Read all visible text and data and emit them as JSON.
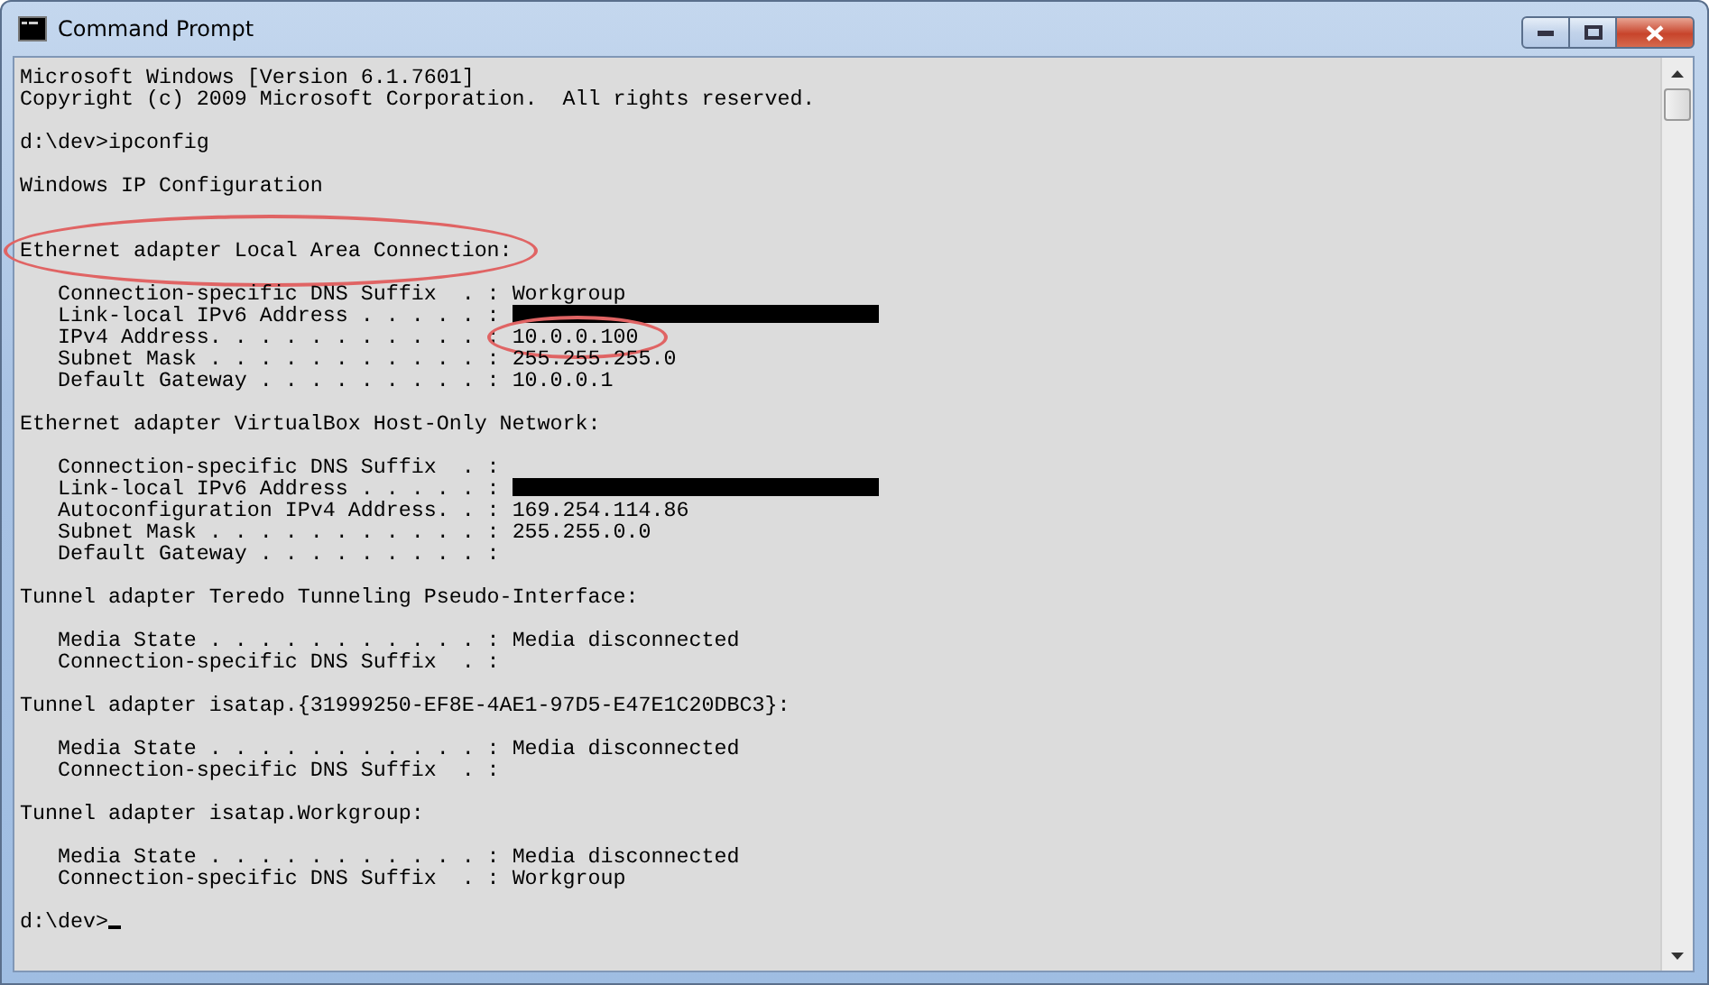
{
  "window": {
    "title": "Command Prompt"
  },
  "console": {
    "lines": [
      {
        "kind": "text",
        "text": "Microsoft Windows [Version 6.1.7601]"
      },
      {
        "kind": "text",
        "text": "Copyright (c) 2009 Microsoft Corporation.  All rights reserved."
      },
      {
        "kind": "blank"
      },
      {
        "kind": "text",
        "text": "d:\\dev>ipconfig"
      },
      {
        "kind": "blank"
      },
      {
        "kind": "text",
        "text": "Windows IP Configuration"
      },
      {
        "kind": "blank"
      },
      {
        "kind": "blank"
      },
      {
        "kind": "text",
        "text": "Ethernet adapter Local Area Connection:",
        "circled": true
      },
      {
        "kind": "blank"
      },
      {
        "kind": "field",
        "label": "Connection-specific DNS Suffix  . :",
        "value": "Workgroup"
      },
      {
        "kind": "field",
        "label": "Link-local IPv6 Address . . . . . :",
        "redacted": true
      },
      {
        "kind": "field",
        "label": "IPv4 Address. . . . . . . . . . . :",
        "value": "10.0.0.100",
        "circled": true
      },
      {
        "kind": "field",
        "label": "Subnet Mask . . . . . . . . . . . :",
        "value": "255.255.255.0"
      },
      {
        "kind": "field",
        "label": "Default Gateway . . . . . . . . . :",
        "value": "10.0.0.1"
      },
      {
        "kind": "blank"
      },
      {
        "kind": "text",
        "text": "Ethernet adapter VirtualBox Host-Only Network:"
      },
      {
        "kind": "blank"
      },
      {
        "kind": "field",
        "label": "Connection-specific DNS Suffix  . :"
      },
      {
        "kind": "field",
        "label": "Link-local IPv6 Address . . . . . :",
        "redacted": true
      },
      {
        "kind": "field",
        "label": "Autoconfiguration IPv4 Address. . :",
        "value": "169.254.114.86"
      },
      {
        "kind": "field",
        "label": "Subnet Mask . . . . . . . . . . . :",
        "value": "255.255.0.0"
      },
      {
        "kind": "field",
        "label": "Default Gateway . . . . . . . . . :"
      },
      {
        "kind": "blank"
      },
      {
        "kind": "text",
        "text": "Tunnel adapter Teredo Tunneling Pseudo-Interface:"
      },
      {
        "kind": "blank"
      },
      {
        "kind": "field",
        "label": "Media State . . . . . . . . . . . :",
        "value": "Media disconnected"
      },
      {
        "kind": "field",
        "label": "Connection-specific DNS Suffix  . :"
      },
      {
        "kind": "blank"
      },
      {
        "kind": "text",
        "text": "Tunnel adapter isatap.{31999250-EF8E-4AE1-97D5-E47E1C20DBC3}:"
      },
      {
        "kind": "blank"
      },
      {
        "kind": "field",
        "label": "Media State . . . . . . . . . . . :",
        "value": "Media disconnected"
      },
      {
        "kind": "field",
        "label": "Connection-specific DNS Suffix  . :"
      },
      {
        "kind": "blank"
      },
      {
        "kind": "text",
        "text": "Tunnel adapter isatap.Workgroup:"
      },
      {
        "kind": "blank"
      },
      {
        "kind": "field",
        "label": "Media State . . . . . . . . . . . :",
        "value": "Media disconnected"
      },
      {
        "kind": "field",
        "label": "Connection-specific DNS Suffix  . :",
        "value": "Workgroup"
      },
      {
        "kind": "blank"
      },
      {
        "kind": "prompt",
        "text": "d:\\dev>",
        "cursor": true
      }
    ]
  }
}
